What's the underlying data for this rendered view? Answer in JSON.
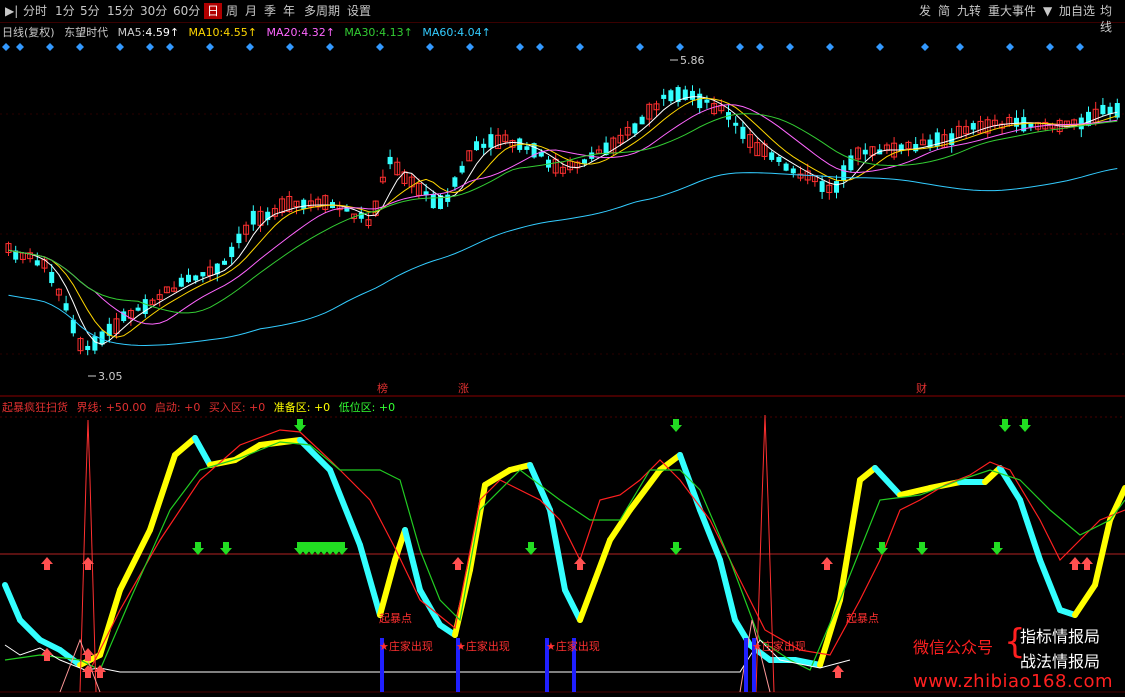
{
  "toolbar": {
    "left_items": [
      "分时",
      "1分",
      "5分",
      "15分",
      "30分",
      "60分",
      "日",
      "周",
      "月",
      "季",
      "年",
      "多周期",
      "设置"
    ],
    "selected": "日",
    "right_items": [
      "发",
      "简",
      "九转",
      "重大事件",
      "加自选",
      "均线"
    ]
  },
  "chart_header": {
    "period": "日线(复权)",
    "stock_name": "东望时代",
    "ma": [
      {
        "label": "MA5:",
        "value": "4.59↑",
        "color": "#ffffff"
      },
      {
        "label": "MA10:",
        "value": "4.55↑",
        "color": "#ffd700"
      },
      {
        "label": "MA20:",
        "value": "4.32↑",
        "color": "#ff66ff"
      },
      {
        "label": "MA30:",
        "value": "4.13↑",
        "color": "#33cc33"
      },
      {
        "label": "MA60:",
        "value": "4.04↑",
        "color": "#33ccff"
      }
    ]
  },
  "price_marks": {
    "high": "5.86",
    "low": "3.05"
  },
  "event_marks": [
    "榜",
    "涨",
    "财"
  ],
  "indicator_header": [
    {
      "text": "起暴疯狂扫货",
      "color": "#ff3030"
    },
    {
      "text": "界线: +50.00",
      "color": "#ff3030"
    },
    {
      "text": "启动: +0",
      "color": "#ff3030"
    },
    {
      "text": "买入区: +0",
      "color": "#ff3030"
    },
    {
      "text": "准备区: +0",
      "color": "#ffff00"
    },
    {
      "text": "低位区: +0",
      "color": "#33ff33"
    }
  ],
  "annotations": {
    "start_point": "起暴点",
    "banker": "★庄家出现"
  },
  "watermark": {
    "wechat": "微信公众号",
    "line1": "指标情报局",
    "line2": "战法情报局",
    "url": "www.zhibiao168.com"
  },
  "colors": {
    "up": "#ff3030",
    "down": "#33ffff",
    "bg": "#000000",
    "grid": "#4a0000"
  }
}
